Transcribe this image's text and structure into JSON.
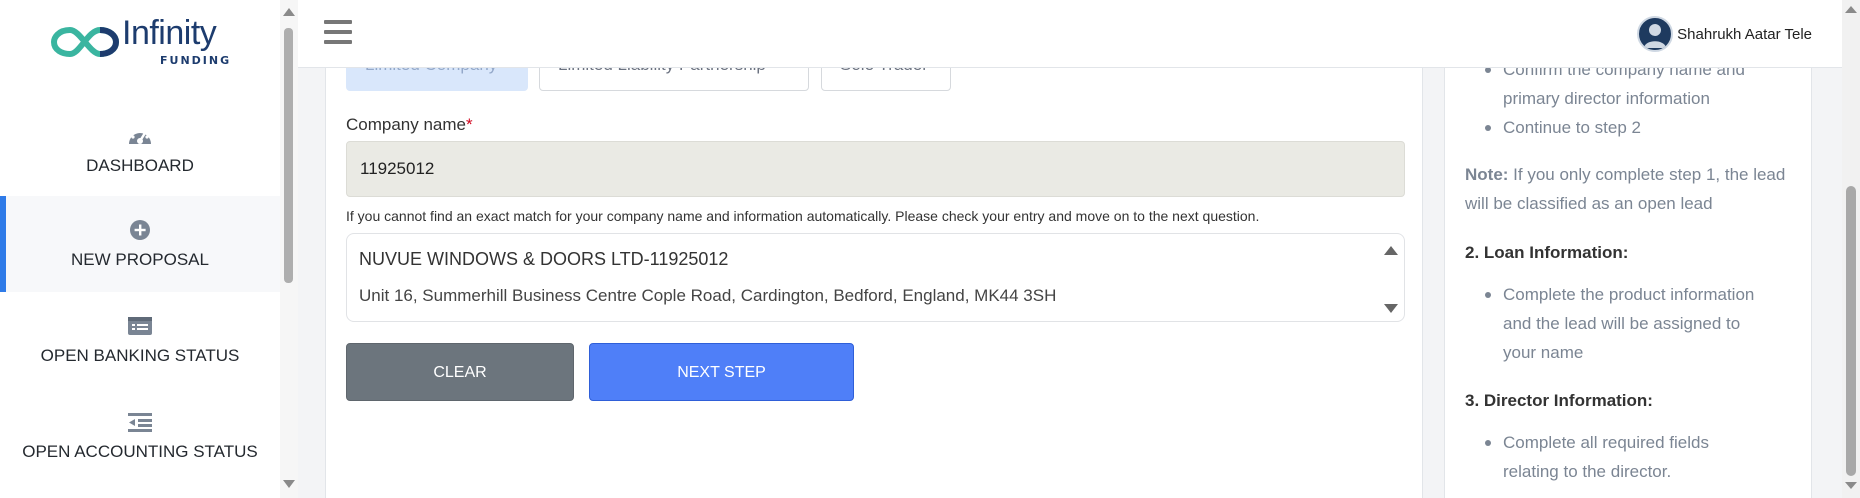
{
  "brand": {
    "name": "Infinity",
    "sub": "FUNDING",
    "color": "#1d3c6e",
    "accent": "#3ab5a0"
  },
  "sidebar": {
    "items": [
      {
        "label": "DASHBOARD",
        "icon": "dashboard-gauge-icon"
      },
      {
        "label": "NEW PROPOSAL",
        "icon": "plus-circle-icon",
        "active": true
      },
      {
        "label": "OPEN BANKING STATUS",
        "icon": "list-card-icon"
      },
      {
        "label": "OPEN ACCOUNTING STATUS",
        "icon": "indent-list-icon"
      }
    ]
  },
  "header": {
    "user_name": "Shahrukh Aatar Tele"
  },
  "form": {
    "company_types": [
      "Limited Company",
      "Limited Liability Partnership",
      "Sole Trader"
    ],
    "company_label": "Company name",
    "required_mark": "*",
    "company_value": "11925012",
    "help_text": "If you cannot find an exact match for your company name and information automatically. Please check your entry and move on to the next question.",
    "match": {
      "name": "NUVUE WINDOWS & DOORS LTD-11925012",
      "address": "Unit 16, Summerhill Business Centre Cople Road, Cardington, Bedford, England, MK44 3SH"
    },
    "clear_label": "CLEAR",
    "next_label": "NEXT STEP"
  },
  "info": {
    "step1_items": [
      "Confirm the company name and primary director information",
      "Continue to step 2"
    ],
    "note_label": "Note:",
    "note_text": " If you only complete step 1, the lead will be classified as an open lead",
    "section2": "2. Loan Information:",
    "step2_items": [
      "Complete the product information and the lead will be assigned to your name"
    ],
    "section3": "3. Director Information:",
    "step3_items": [
      "Complete all required fields relating to the director."
    ]
  },
  "colors": {
    "primary": "#4f7ff8",
    "secondary": "#6c757d",
    "active_bar": "#2f7be8"
  }
}
